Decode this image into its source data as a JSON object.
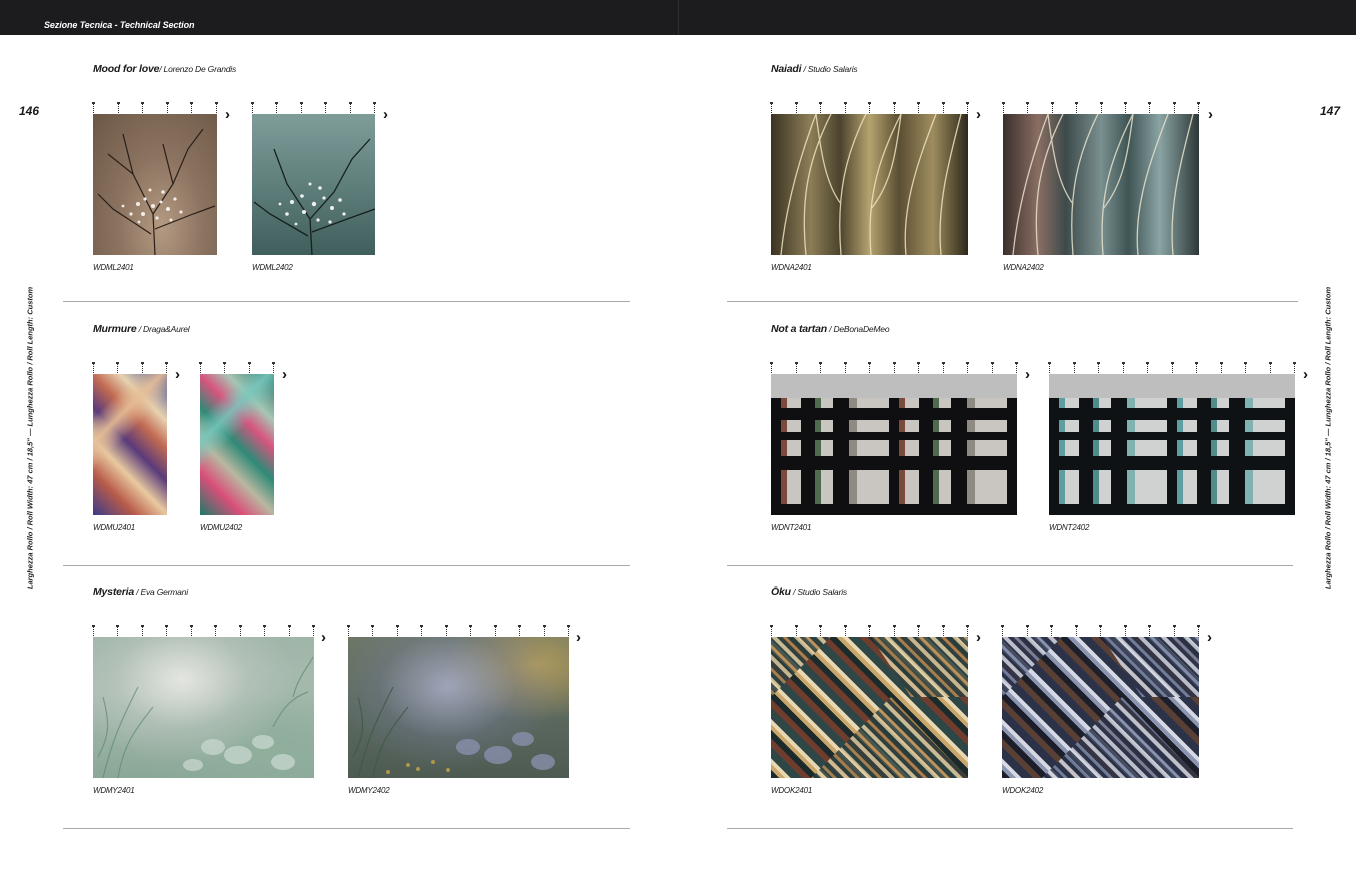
{
  "header": {
    "title": "Sezione Tecnica - Technical Section"
  },
  "pages": {
    "left": "146",
    "right": "147"
  },
  "side_label": "Larghezza Rollo / Roll Width: 47 cm / 18,5\" — Lunghezza Rollo / Roll Length: Custom",
  "collections": {
    "mood": {
      "name": "Mood for love",
      "designer": "/ Lorenzo De Grandis",
      "codes": [
        "WDML2401",
        "WDML2402"
      ]
    },
    "murmure": {
      "name": "Murmure",
      "designer": " / Draga&Aurel",
      "codes": [
        "WDMU2401",
        "WDMU2402"
      ]
    },
    "mysteria": {
      "name": "Mysteria",
      "designer": " / Eva Germani",
      "codes": [
        "WDMY2401",
        "WDMY2402"
      ]
    },
    "naiadi": {
      "name": "Naiadi",
      "designer": " / Studio Salaris",
      "codes": [
        "WDNA2401",
        "WDNA2402"
      ]
    },
    "tartan": {
      "name": "Not a tartan",
      "designer": " / DeBonaDeMeo",
      "codes": [
        "WDNT2401",
        "WDNT2402"
      ]
    },
    "oku": {
      "name": "Ōku",
      "designer": " / Studio Salaris",
      "codes": [
        "WDOK2401",
        "WDOK2402"
      ]
    }
  },
  "icons": {
    "next": "chevron-right-icon"
  },
  "colors": {
    "header_bg": "#1c1b1d",
    "divider": "#a9a9a9"
  }
}
